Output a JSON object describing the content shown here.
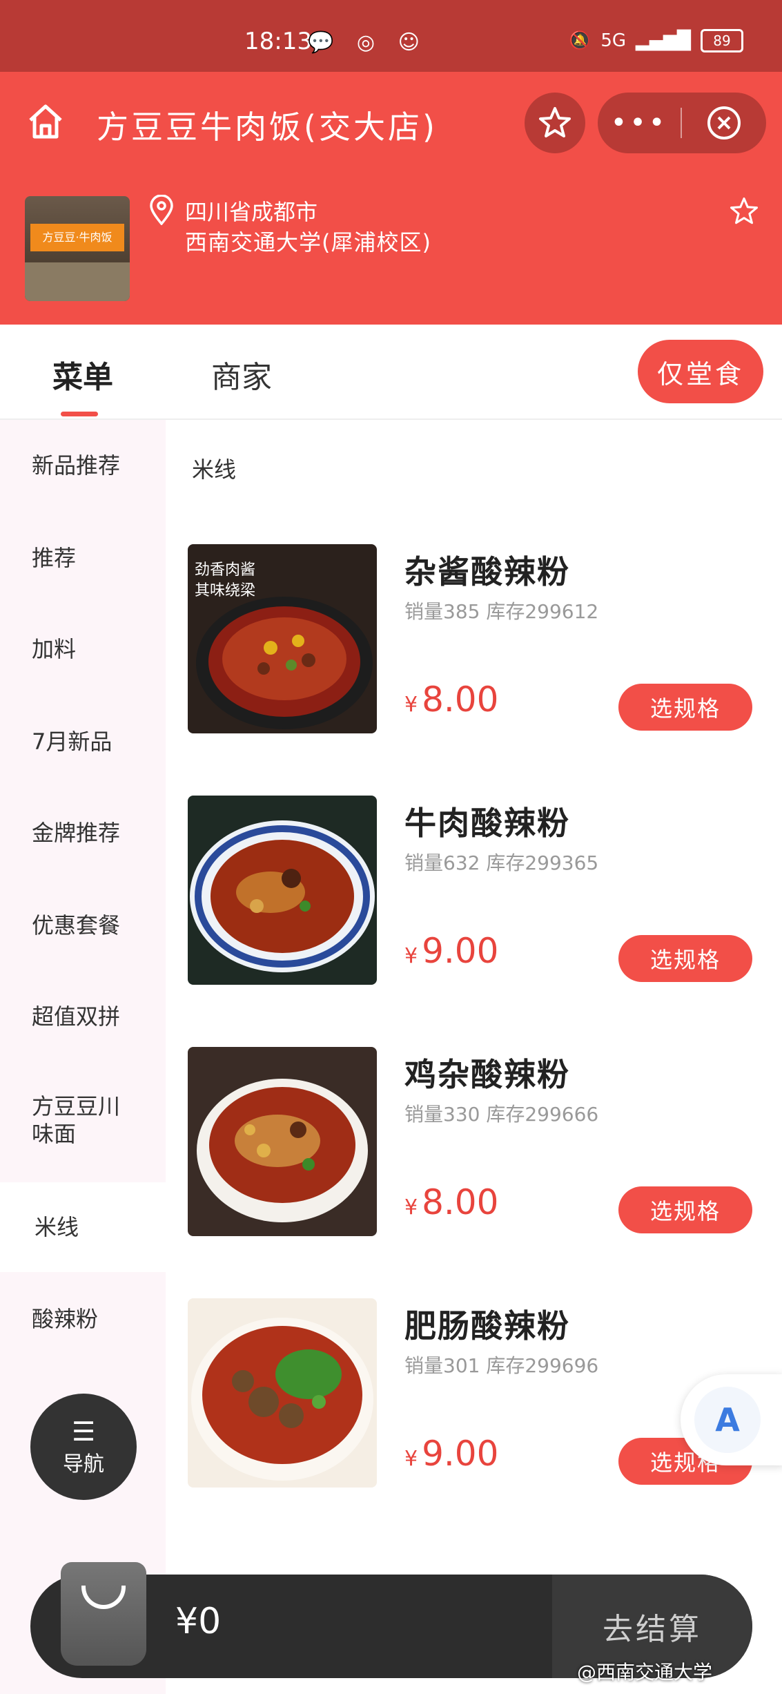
{
  "status_bar": {
    "time": "18:13",
    "network": "5G",
    "battery": "89"
  },
  "header": {
    "title": "方豆豆牛肉饭(交大店)",
    "address_line1": "四川省成都市",
    "address_line2": "西南交通大学(犀浦校区)",
    "store_sign": "方豆豆·牛肉饭",
    "more_label": "•••"
  },
  "tabs": {
    "menu": "菜单",
    "merchant": "商家",
    "dine_in": "仅堂食"
  },
  "sidebar": {
    "items": [
      "新品推荐",
      "推荐",
      "加料",
      "7月新品",
      "金牌推荐",
      "优惠套餐",
      "超值双拼",
      "方豆豆川味面",
      "米线",
      "酸辣粉"
    ],
    "active": "米线",
    "nav_label": "导航",
    "nav_glyph": "☰"
  },
  "section_title": "米线",
  "dishes": [
    {
      "name": "杂酱酸辣粉",
      "stats": "销量385 库存299612",
      "currency": "¥",
      "price": "8.00",
      "button": "选规格",
      "image_caption": "劲香肉酱\n其味绕梁"
    },
    {
      "name": "牛肉酸辣粉",
      "stats": "销量632 库存299365",
      "currency": "¥",
      "price": "9.00",
      "button": "选规格"
    },
    {
      "name": "鸡杂酸辣粉",
      "stats": "销量330 库存299666",
      "currency": "¥",
      "price": "8.00",
      "button": "选规格"
    },
    {
      "name": "肥肠酸辣粉",
      "stats": "销量301 库存299696",
      "currency": "¥",
      "price": "9.00",
      "button": "选规格"
    }
  ],
  "cart": {
    "total": "¥0",
    "checkout": "去结算"
  },
  "translate_glyph": "A",
  "watermark": "@西南交通大学",
  "colors": {
    "accent": "#f24f48",
    "status_bar": "#b83a35",
    "price": "#e8443d",
    "cart_bg": "#2d2d2d"
  }
}
